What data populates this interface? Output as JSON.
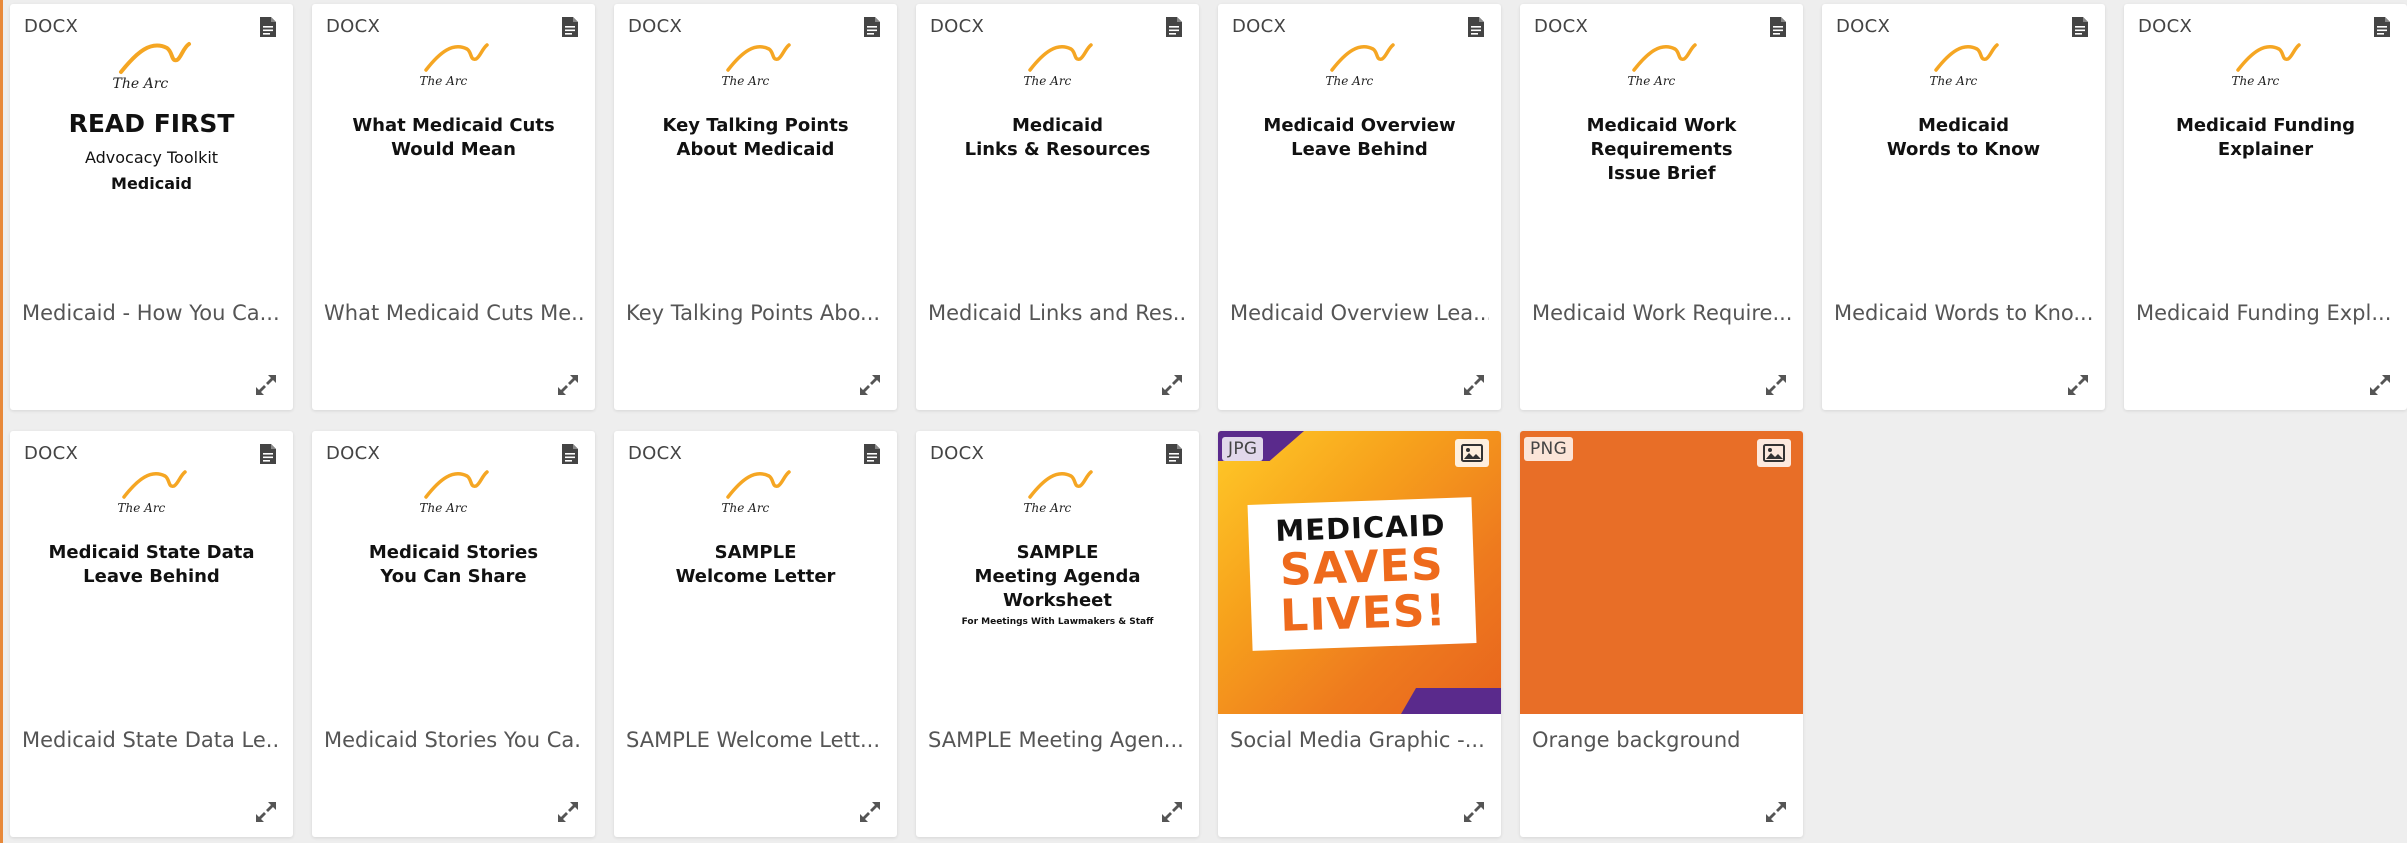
{
  "colors": {
    "page_background": "#eeeeee",
    "card_background": "#ffffff",
    "logo_orange": "#f5a623",
    "graphic_orange": "#ee6a1c",
    "graphic_purple": "#5a2a8c",
    "orange_background": "#e86e27"
  },
  "logo_text": "The Arc",
  "cards": [
    {
      "type": "DOCX",
      "icon": "document-icon",
      "caption": "Medicaid - How You Ca...",
      "thumb_big": "READ FIRST",
      "thumb_sub1": "Advocacy Toolkit",
      "thumb_sub2": "Medicaid"
    },
    {
      "type": "DOCX",
      "icon": "document-icon",
      "caption": "What Medicaid Cuts Me...",
      "thumb_title": "What Medicaid Cuts\nWould Mean"
    },
    {
      "type": "DOCX",
      "icon": "document-icon",
      "caption": "Key Talking Points Abo...",
      "thumb_title": "Key Talking Points\nAbout Medicaid"
    },
    {
      "type": "DOCX",
      "icon": "document-icon",
      "caption": "Medicaid Links and Res...",
      "thumb_title": "Medicaid\nLinks & Resources"
    },
    {
      "type": "DOCX",
      "icon": "document-icon",
      "caption": "Medicaid Overview Lea...",
      "thumb_title": "Medicaid Overview\nLeave Behind"
    },
    {
      "type": "DOCX",
      "icon": "document-icon",
      "caption": "Medicaid Work Require...",
      "thumb_title": "Medicaid Work\nRequirements\nIssue Brief"
    },
    {
      "type": "DOCX",
      "icon": "document-icon",
      "caption": "Medicaid Words to Kno...",
      "thumb_title": "Medicaid\nWords to Know"
    },
    {
      "type": "DOCX",
      "icon": "document-icon",
      "caption": "Medicaid Funding Expl...",
      "thumb_title": "Medicaid Funding\nExplainer"
    },
    {
      "type": "DOCX",
      "icon": "document-icon",
      "caption": "Medicaid State Data Le...",
      "thumb_title": "Medicaid State Data\nLeave Behind"
    },
    {
      "type": "DOCX",
      "icon": "document-icon",
      "caption": "Medicaid Stories You Ca...",
      "thumb_title": "Medicaid Stories\nYou Can Share"
    },
    {
      "type": "DOCX",
      "icon": "document-icon",
      "caption": "SAMPLE Welcome Lett...",
      "thumb_title": "SAMPLE\nWelcome Letter"
    },
    {
      "type": "DOCX",
      "icon": "document-icon",
      "caption": "SAMPLE Meeting Agen...",
      "thumb_title": "SAMPLE\nMeeting Agenda\nWorksheet",
      "thumb_small": "For Meetings With Lawmakers & Staff"
    },
    {
      "type": "JPG",
      "icon": "image-icon",
      "caption": "Social Media Graphic -...",
      "graphic_line1": "MEDICAID",
      "graphic_line2": "SAVES",
      "graphic_line3": "LIVES!"
    },
    {
      "type": "PNG",
      "icon": "image-icon",
      "caption": "Orange background"
    }
  ]
}
